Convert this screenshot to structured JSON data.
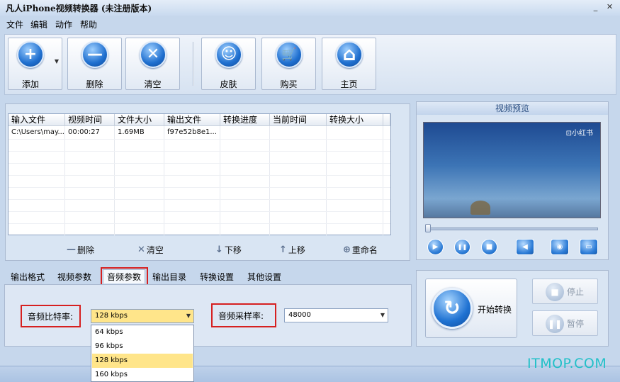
{
  "window": {
    "title": "凡人iPhone视频转换器 (未注册版本)",
    "min": "_",
    "close": "✕"
  },
  "menu": [
    "文件",
    "编辑",
    "动作",
    "帮助"
  ],
  "toolbar": {
    "buttons": [
      {
        "label": "添加",
        "icon": "plus-icon",
        "glyph": "+"
      },
      {
        "label": "删除",
        "icon": "minus-icon",
        "glyph": "—"
      },
      {
        "label": "清空",
        "icon": "x-circle-icon",
        "glyph": "✕"
      },
      {
        "label": "皮肤",
        "icon": "smiley-icon",
        "glyph": "☺"
      },
      {
        "label": "购买",
        "icon": "cart-icon",
        "glyph": "🛒"
      },
      {
        "label": "主页",
        "icon": "home-icon",
        "glyph": "⌂"
      }
    ],
    "add_arrow": "▼"
  },
  "file_list": {
    "columns": [
      "输入文件",
      "视频时间",
      "文件大小",
      "输出文件",
      "转换进度",
      "当前时间",
      "转换大小"
    ],
    "rows": [
      [
        "C:\\Users\\may...",
        "00:00:27",
        "1.69MB",
        "f97e52b8e1...",
        "",
        "",
        ""
      ]
    ]
  },
  "list_actions": [
    {
      "label": "删除",
      "glyph": "—"
    },
    {
      "label": "清空",
      "glyph": "✕"
    },
    {
      "label": "下移",
      "glyph": "↓"
    },
    {
      "label": "上移",
      "glyph": "↑"
    },
    {
      "label": "重命名",
      "glyph": "⊕"
    }
  ],
  "preview": {
    "title": "视频预览",
    "watermark": "⊡小红书",
    "controls": [
      {
        "name": "play-button",
        "glyph": "▶"
      },
      {
        "name": "pause-button",
        "glyph": "❚❚"
      },
      {
        "name": "stop-button",
        "glyph": "■"
      },
      {
        "name": "volume-button",
        "glyph": "◀"
      },
      {
        "name": "snapshot-button",
        "glyph": "◉"
      },
      {
        "name": "open-folder-button",
        "glyph": "▭"
      }
    ]
  },
  "tabs": [
    "输出格式",
    "视频参数",
    "音频参数",
    "输出目录",
    "转换设置",
    "其他设置"
  ],
  "audio": {
    "bitrate_label": "音频比特率:",
    "bitrate_value": "128 kbps",
    "bitrate_options": [
      "64 kbps",
      "96 kbps",
      "128 kbps",
      "160 kbps"
    ],
    "samplerate_label": "音频采样率:",
    "samplerate_value": "48000"
  },
  "convert": {
    "start": "开始转换",
    "stop": "停止",
    "pause": "暂停"
  },
  "site_watermark": "ITMOP.COM",
  "colors": {
    "highlight": "#ffe58a",
    "red_box": "#d62020",
    "accent": "#1f72d2"
  }
}
